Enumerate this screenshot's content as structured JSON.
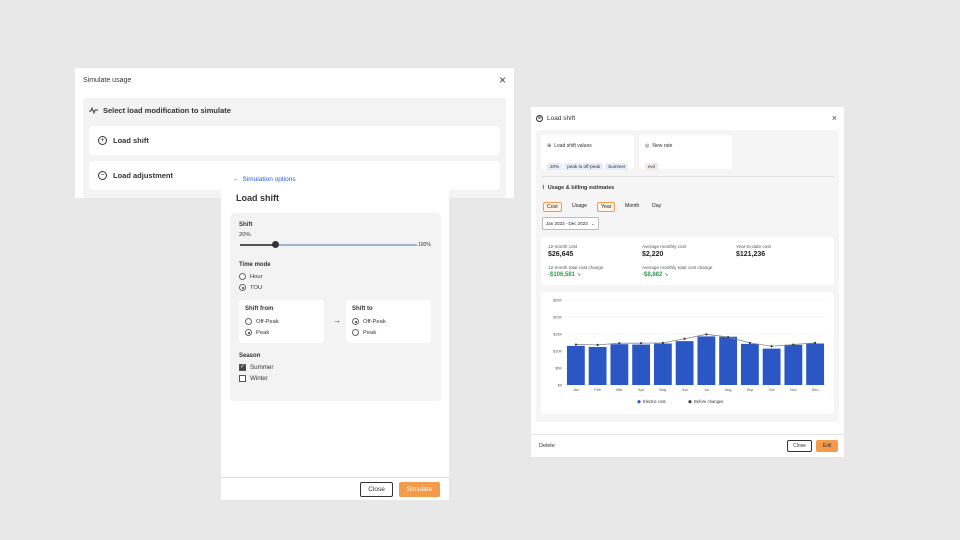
{
  "simulate_usage": {
    "title": "Simulate usage",
    "close_icon": "×",
    "select_heading": "Select load modification to simulate",
    "options": [
      {
        "label": "Load shift",
        "icon": "plus-circle-icon",
        "glyph": "+"
      },
      {
        "label": "Load adjustment",
        "icon": "minus-circle-icon",
        "glyph": "−"
      }
    ]
  },
  "simulation_options": {
    "back_label": "Simulation options",
    "title": "Load shift",
    "shift": {
      "label": "Shift",
      "value_text": "20%",
      "max_text": "100%",
      "value": 0.2
    },
    "time_mode": {
      "label": "Time mode",
      "options": [
        {
          "label": "Hour",
          "selected": false
        },
        {
          "label": "TOU",
          "selected": true
        }
      ]
    },
    "shift_from": {
      "label": "Shift from",
      "options": [
        {
          "label": "Off-Peak",
          "selected": false
        },
        {
          "label": "Peak",
          "selected": true
        }
      ]
    },
    "shift_to": {
      "label": "Shift to",
      "options": [
        {
          "label": "Off-Peak",
          "selected": true
        },
        {
          "label": "Peak",
          "selected": false
        }
      ]
    },
    "arrow": "→",
    "season": {
      "label": "Season",
      "options": [
        {
          "label": "Summer",
          "checked": true
        },
        {
          "label": "Winter",
          "checked": false
        }
      ]
    },
    "close_label": "Close",
    "simulate_label": "Simulate"
  },
  "load_panel": {
    "title": "Load shift",
    "close_icon": "×",
    "load_shift_values": {
      "label": "Load shift values",
      "chips": [
        "20%",
        "peak to off-peak",
        "Summer"
      ]
    },
    "new_rate": {
      "label": "New rate",
      "chip": "evil"
    },
    "usage_heading": "Usage & billing estimates",
    "tabs_left": [
      {
        "label": "Cost",
        "active": true
      },
      {
        "label": "Usage",
        "active": false
      }
    ],
    "tabs_right": [
      {
        "label": "Year",
        "active": true
      },
      {
        "label": "Month",
        "active": false
      },
      {
        "label": "Day",
        "active": false
      }
    ],
    "date_range": "Jan 2023 - Dec 2023",
    "stats": {
      "twelve_month_cost_label": "12-month cost",
      "twelve_month_cost": "$26,645",
      "avg_monthly_cost_label": "Average monthly cost",
      "avg_monthly_cost": "$2,220",
      "ytd_cost_label": "Year-to-date cost",
      "ytd_cost": "$121,236",
      "total_change_label": "12-month total cost change",
      "total_change": "-$106,581",
      "avg_change_label": "Average monthly total cost change",
      "avg_change": "-$8,882"
    },
    "delete_label": "Delete",
    "close_label": "Close",
    "edit_label": "Edit"
  },
  "chart_data": {
    "type": "bar",
    "categories": [
      "Jan",
      "Feb",
      "Mar",
      "Apr",
      "May",
      "Jun",
      "Jul",
      "Aug",
      "Sep",
      "Oct",
      "Nov",
      "Dec"
    ],
    "series": [
      {
        "name": "Electric cost",
        "type": "bar",
        "color": "#2b57c4",
        "values": [
          11500,
          11200,
          12000,
          11900,
          12200,
          12900,
          14300,
          14200,
          12100,
          10700,
          11800,
          12200
        ]
      },
      {
        "name": "Before changes",
        "type": "line",
        "color": "#666666",
        "values": [
          11900,
          11800,
          12300,
          12300,
          12400,
          13600,
          14900,
          14100,
          12400,
          11400,
          11900,
          12400
        ]
      }
    ],
    "y_ticks": [
      "$0",
      "$5K",
      "$10K",
      "$15K",
      "$20K",
      "$25K"
    ],
    "ylim": [
      0,
      25000
    ],
    "legend": [
      "Electric cost",
      "Before changes"
    ]
  }
}
